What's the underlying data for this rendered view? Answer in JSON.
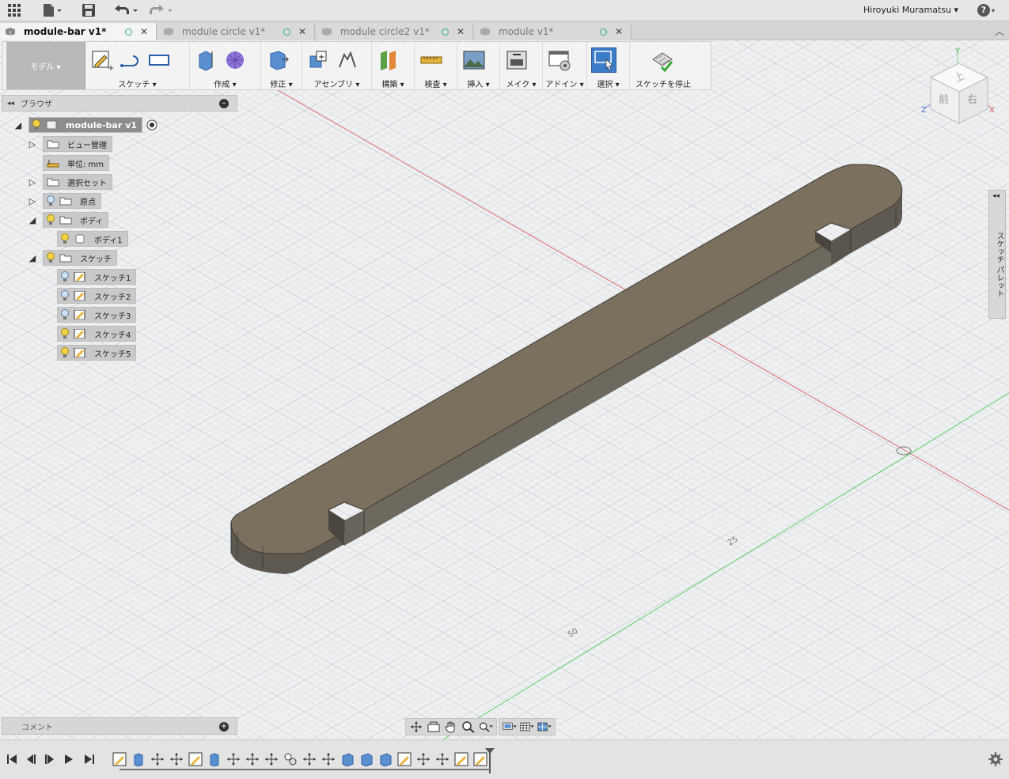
{
  "app": {
    "user": "Hiroyuki Muramatsu"
  },
  "tabs": [
    {
      "label": "module-bar v1*",
      "active": true
    },
    {
      "label": "module circle v1*",
      "active": false
    },
    {
      "label": "module circle2 v1*",
      "active": false
    },
    {
      "label": "module v1*",
      "active": false
    }
  ],
  "ribbon": {
    "workspace": "モデル ▾",
    "groups": [
      {
        "label": "スケッチ ▾"
      },
      {
        "label": "作成 ▾"
      },
      {
        "label": "修正 ▾"
      },
      {
        "label": "アセンブリ ▾"
      },
      {
        "label": "構築 ▾"
      },
      {
        "label": "検査 ▾"
      },
      {
        "label": "挿入 ▾"
      },
      {
        "label": "メイク ▾"
      },
      {
        "label": "アドイン ▾"
      },
      {
        "label": "選択 ▾"
      },
      {
        "label": "スケッチを停止"
      }
    ]
  },
  "browser": {
    "title": "ブラウザ",
    "root": "module-bar v1",
    "nodes": [
      {
        "label": "ビュー管理"
      },
      {
        "label": "単位: mm"
      },
      {
        "label": "選択セット"
      },
      {
        "label": "原点"
      },
      {
        "label": "ボディ"
      },
      {
        "label": "ボディ1"
      },
      {
        "label": "スケッチ"
      },
      {
        "label": "スケッチ1"
      },
      {
        "label": "スケッチ2"
      },
      {
        "label": "スケッチ3"
      },
      {
        "label": "スケッチ4"
      },
      {
        "label": "スケッチ5"
      }
    ]
  },
  "comments": {
    "label": "コメント"
  },
  "palette": {
    "label": "スケッチ パレット"
  },
  "viewport": {
    "axis_labels": [
      "25",
      "50"
    ]
  },
  "viewcube": {
    "top": "上",
    "front": "前",
    "right": "右",
    "axis_x": "X",
    "axis_y": "Y",
    "axis_z": "Z"
  }
}
